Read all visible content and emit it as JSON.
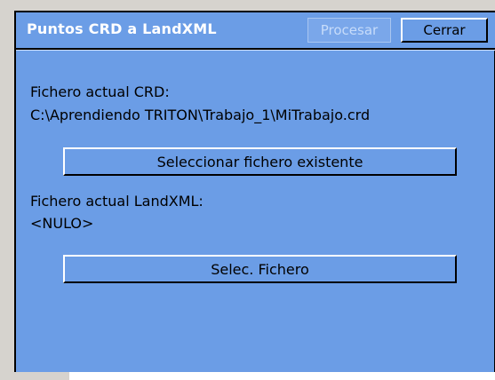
{
  "window": {
    "title": "Puntos CRD a LandXML",
    "buttons": {
      "procesar": "Procesar",
      "cerrar": "Cerrar"
    }
  },
  "crd": {
    "label": "Fichero actual CRD:",
    "path": "C:\\Aprendiendo TRITON\\Trabajo_1\\MiTrabajo.crd",
    "select_button": "Seleccionar fichero existente"
  },
  "landxml": {
    "label": "Fichero actual LandXML:",
    "value": "<NULO>",
    "select_button": "Selec. Fichero"
  },
  "colors": {
    "window_bg": "#6b9de6",
    "title_text": "#ffffff",
    "disabled_text": "#c7dcfa"
  }
}
